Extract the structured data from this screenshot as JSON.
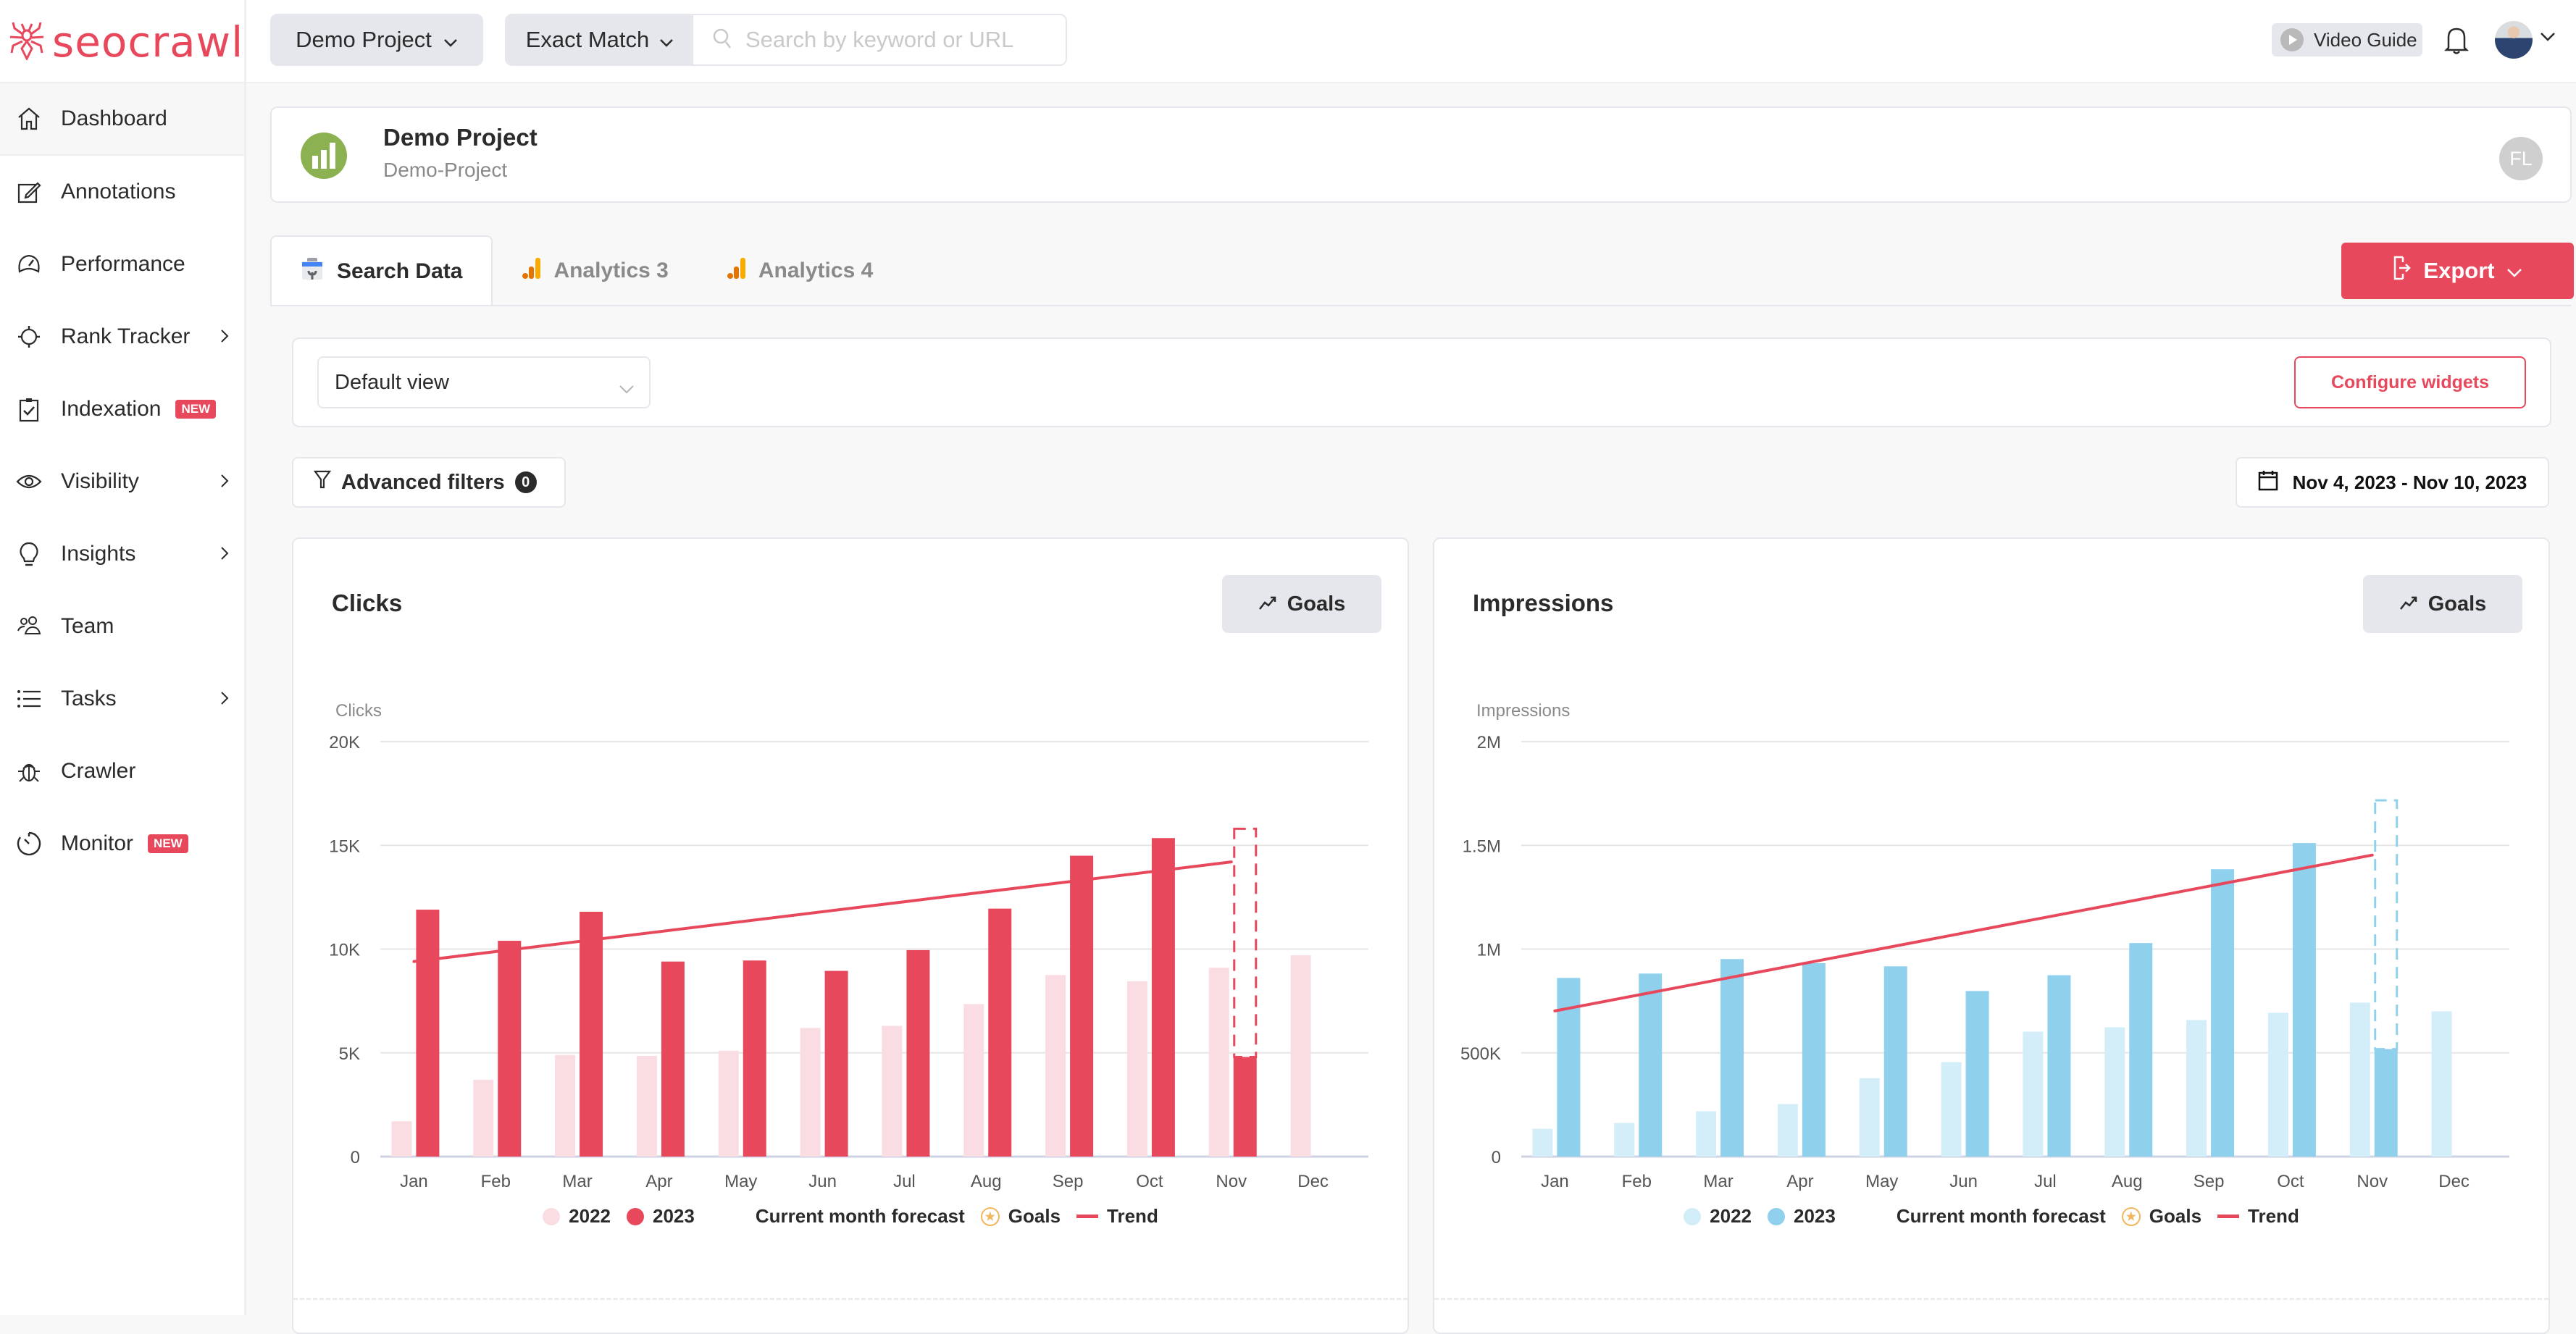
{
  "brand": {
    "name": "seocrawl",
    "accent": "#e8485c"
  },
  "topbar": {
    "project_select": "Demo Project",
    "match_select": "Exact Match",
    "search_placeholder": "Search by keyword or URL",
    "search_value": "",
    "video_guide": "Video Guide"
  },
  "sidebar": {
    "items": [
      {
        "label": "Dashboard",
        "icon": "home-icon",
        "active": true
      },
      {
        "label": "Annotations",
        "icon": "edit-icon"
      },
      {
        "label": "Performance",
        "icon": "gauge-icon"
      },
      {
        "label": "Rank Tracker",
        "icon": "crosshair-icon",
        "chevron": true
      },
      {
        "label": "Indexation",
        "icon": "clipboard-check-icon",
        "badge": "NEW"
      },
      {
        "label": "Visibility",
        "icon": "eye-icon",
        "chevron": true
      },
      {
        "label": "Insights",
        "icon": "lightbulb-icon",
        "chevron": true
      },
      {
        "label": "Team",
        "icon": "users-icon"
      },
      {
        "label": "Tasks",
        "icon": "list-icon",
        "chevron": true
      },
      {
        "label": "Crawler",
        "icon": "bug-icon"
      },
      {
        "label": "Monitor",
        "icon": "timer-icon",
        "badge": "NEW"
      }
    ]
  },
  "project": {
    "name": "Demo Project",
    "slug": "Demo-Project",
    "user_initials": "FL",
    "icon_color": "#8bb151"
  },
  "tabs": [
    {
      "label": "Search Data",
      "active": true
    },
    {
      "label": "Analytics 3"
    },
    {
      "label": "Analytics 4"
    }
  ],
  "export_label": "Export",
  "view": {
    "selected": "Default view",
    "configure_label": "Configure widgets"
  },
  "filters": {
    "label": "Advanced filters",
    "count": "0"
  },
  "date_range": "Nov 4, 2023 - Nov 10, 2023",
  "legend_labels": {
    "y2022": "2022",
    "y2023": "2023",
    "forecast": "Current month forecast",
    "goals": "Goals",
    "trend": "Trend"
  },
  "goals_label": "Goals",
  "chart_data": [
    {
      "type": "bar",
      "title": "Clicks",
      "ylabel": "Clicks",
      "xlabel": "",
      "categories": [
        "Jan",
        "Feb",
        "Mar",
        "Apr",
        "May",
        "Jun",
        "Jul",
        "Aug",
        "Sep",
        "Oct",
        "Nov",
        "Dec"
      ],
      "ylim": [
        0,
        20000
      ],
      "yticks": [
        0,
        5000,
        10000,
        15000,
        20000
      ],
      "ytick_labels": [
        "0",
        "5K",
        "10K",
        "15K",
        "20K"
      ],
      "grid": true,
      "legend": "bottom",
      "colors": {
        "y2022": "#fadde2",
        "y2023": "#e8485c",
        "trend": "#e8485c",
        "forecast": "#e8485c"
      },
      "series": [
        {
          "name": "2022",
          "values": [
            1700,
            3700,
            4900,
            4850,
            5100,
            6200,
            6300,
            7350,
            8750,
            8450,
            9100,
            9700
          ]
        },
        {
          "name": "2023",
          "values": [
            11900,
            10400,
            11800,
            9400,
            9450,
            8950,
            9950,
            11950,
            14500,
            15350,
            4800,
            null
          ]
        }
      ],
      "forecast": {
        "category": "Nov",
        "value": 15800
      },
      "trend": {
        "from": {
          "category": "Jan",
          "value": 9400
        },
        "to": {
          "category": "Nov",
          "value": 14200
        }
      }
    },
    {
      "type": "bar",
      "title": "Impressions",
      "ylabel": "Impressions",
      "xlabel": "",
      "categories": [
        "Jan",
        "Feb",
        "Mar",
        "Apr",
        "May",
        "Jun",
        "Jul",
        "Aug",
        "Sep",
        "Oct",
        "Nov",
        "Dec"
      ],
      "ylim": [
        0,
        2000000
      ],
      "yticks": [
        0,
        500000,
        1000000,
        1500000,
        2000000
      ],
      "ytick_labels": [
        "0",
        "500K",
        "1M",
        "1.5M",
        "2M"
      ],
      "grid": true,
      "legend": "bottom",
      "colors": {
        "y2022": "#d3eef9",
        "y2023": "#8fd1ed",
        "trend": "#e8485c",
        "forecast": "#8fd1ed"
      },
      "series": [
        {
          "name": "2022",
          "values": [
            134000,
            162000,
            218000,
            253000,
            378000,
            455000,
            602000,
            623000,
            658000,
            693000,
            742000,
            700000
          ]
        },
        {
          "name": "2023",
          "values": [
            861000,
            882000,
            952000,
            932000,
            917000,
            798000,
            874000,
            1029000,
            1385000,
            1511000,
            518000,
            null
          ]
        }
      ],
      "forecast": {
        "category": "Nov",
        "value": 1717000
      },
      "trend": {
        "from": {
          "category": "Jan",
          "value": 702000
        },
        "to": {
          "category": "Nov",
          "value": 1453000
        }
      }
    }
  ]
}
